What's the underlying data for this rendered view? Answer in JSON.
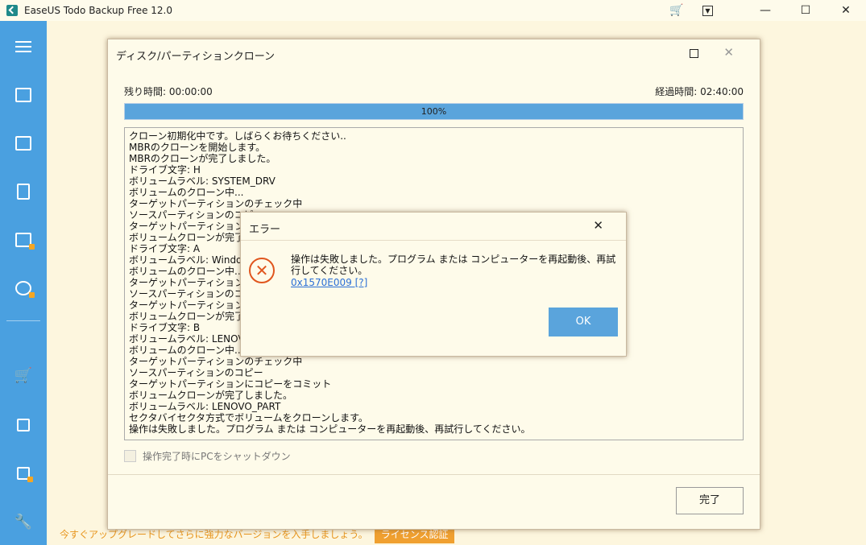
{
  "window": {
    "title": "EaseUS Todo Backup Free 12.0",
    "controls": {
      "minimize": "—",
      "maximize": "☐",
      "close": "✕"
    }
  },
  "sidebar": {
    "items": [
      {
        "icon": "menu-icon"
      },
      {
        "icon": "disk-backup-icon"
      },
      {
        "icon": "system-backup-icon"
      },
      {
        "icon": "file-backup-icon"
      },
      {
        "icon": "mail-backup-icon",
        "locked": true
      },
      {
        "icon": "smart-backup-icon",
        "locked": true
      },
      {
        "icon": "cart-icon"
      },
      {
        "icon": "clone-icon"
      },
      {
        "icon": "tools-icon",
        "locked": true
      },
      {
        "icon": "wrench-icon"
      }
    ]
  },
  "promo": {
    "text": "今すぐアップグレードしてさらに強力なバージョンを入手しましょう。",
    "button": "ライセンス認証"
  },
  "clone_dialog": {
    "title": "ディスク/パーティションクローン",
    "remaining": "残り時間: 00:00:00",
    "elapsed": "経過時間: 02:40:00",
    "progress": 100,
    "progress_label": "100%",
    "log": [
      "クローン初期化中です。しばらくお待ちください..",
      "MBRのクローンを開始します。",
      "MBRのクローンが完了しました。",
      "ドライブ文字: H",
      "ボリュームラベル: SYSTEM_DRV",
      "ボリュームのクローン中...",
      "ターゲットパーティションのチェック中",
      "ソースパーティションのコピ",
      "ターゲットパーティションにコ",
      "ボリュームクローンが完了し",
      "ドライブ文字: A",
      "ボリュームラベル: Windows",
      "ボリュームのクローン中...",
      "ターゲットパーティションのチ",
      "ソースパーティションのコピ",
      "ターゲットパーティションにコ",
      "ボリュームクローンが完了し",
      "ドライブ文字: B",
      "ボリュームラベル: LENOVO",
      "ボリュームのクローン中...",
      "ターゲットパーティションのチェック中",
      "ソースパーティションのコピー",
      "ターゲットパーティションにコピーをコミット",
      "ボリュームクローンが完了しました。",
      "ボリュームラベル: LENOVO_PART",
      "セクタバイセクタ方式でボリュームをクローンします。",
      "操作は失敗しました。プログラム または コンピューターを再起動後、再試行してください。"
    ],
    "shutdown_label": "操作完了時にPCをシャットダウン",
    "done_button": "完了"
  },
  "error_dialog": {
    "title": "エラー",
    "message": "操作は失敗しました。プログラム または コンピューターを再起動後、再試行してください。",
    "link": "0x1570E009 [?]",
    "ok_button": "OK"
  }
}
